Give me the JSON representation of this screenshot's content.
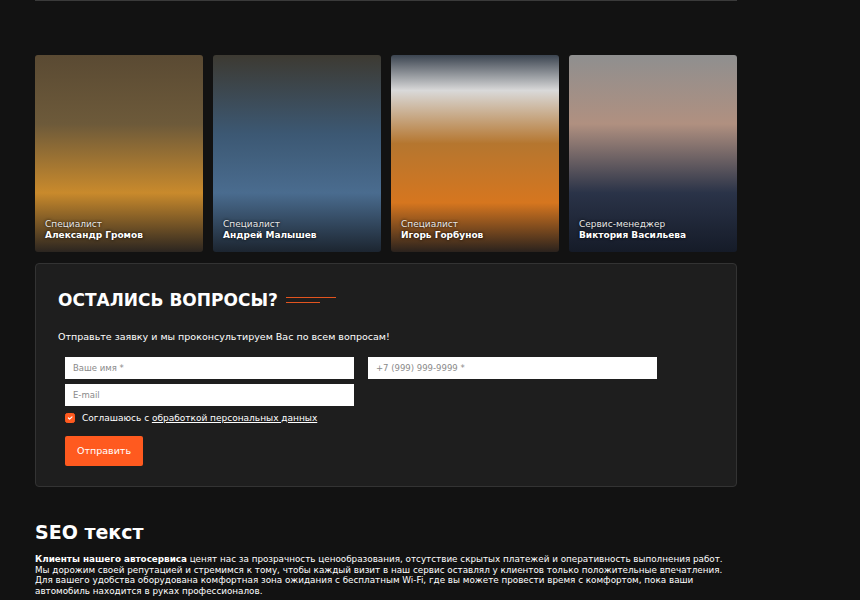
{
  "team": [
    {
      "role": "Специалист",
      "name": "Александр Громов"
    },
    {
      "role": "Специалист",
      "name": "Андрей Малышев"
    },
    {
      "role": "Специалист",
      "name": "Игорь Горбунов"
    },
    {
      "role": "Сервис-менеджер",
      "name": "Виктория Васильева"
    }
  ],
  "form": {
    "title": "ОСТАЛИСЬ ВОПРОСЫ?",
    "subtitle": "Отправьте заявку и мы проконсультируем Вас по всем вопросам!",
    "fields": [
      {
        "placeholder": "Ваше имя *"
      },
      {
        "placeholder": "+7 (999) 999-9999 *"
      },
      {
        "placeholder": "E-mail"
      }
    ],
    "consent": {
      "checked": true,
      "text": "Соглашаюсь с",
      "link": "обработкой персональных данных"
    },
    "submit": "Отправить"
  },
  "seo": {
    "title": "SEO текст",
    "lead": "Клиенты нашего автосервиса",
    "text": "ценят нас за прозрачность ценообразования, отсутствие скрытых платежей и оперативность выполнения работ. Мы дорожим своей репутацией и стремимся к тому, чтобы каждый визит в наш сервис оставлял у клиентов только положительные впечатления. Для вашего удобства оборудована комфортная зона ожидания с бесплатным Wi-Fi, где вы можете провести время с комфортом, пока ваши автомобиль находится в руках профессионалов."
  }
}
